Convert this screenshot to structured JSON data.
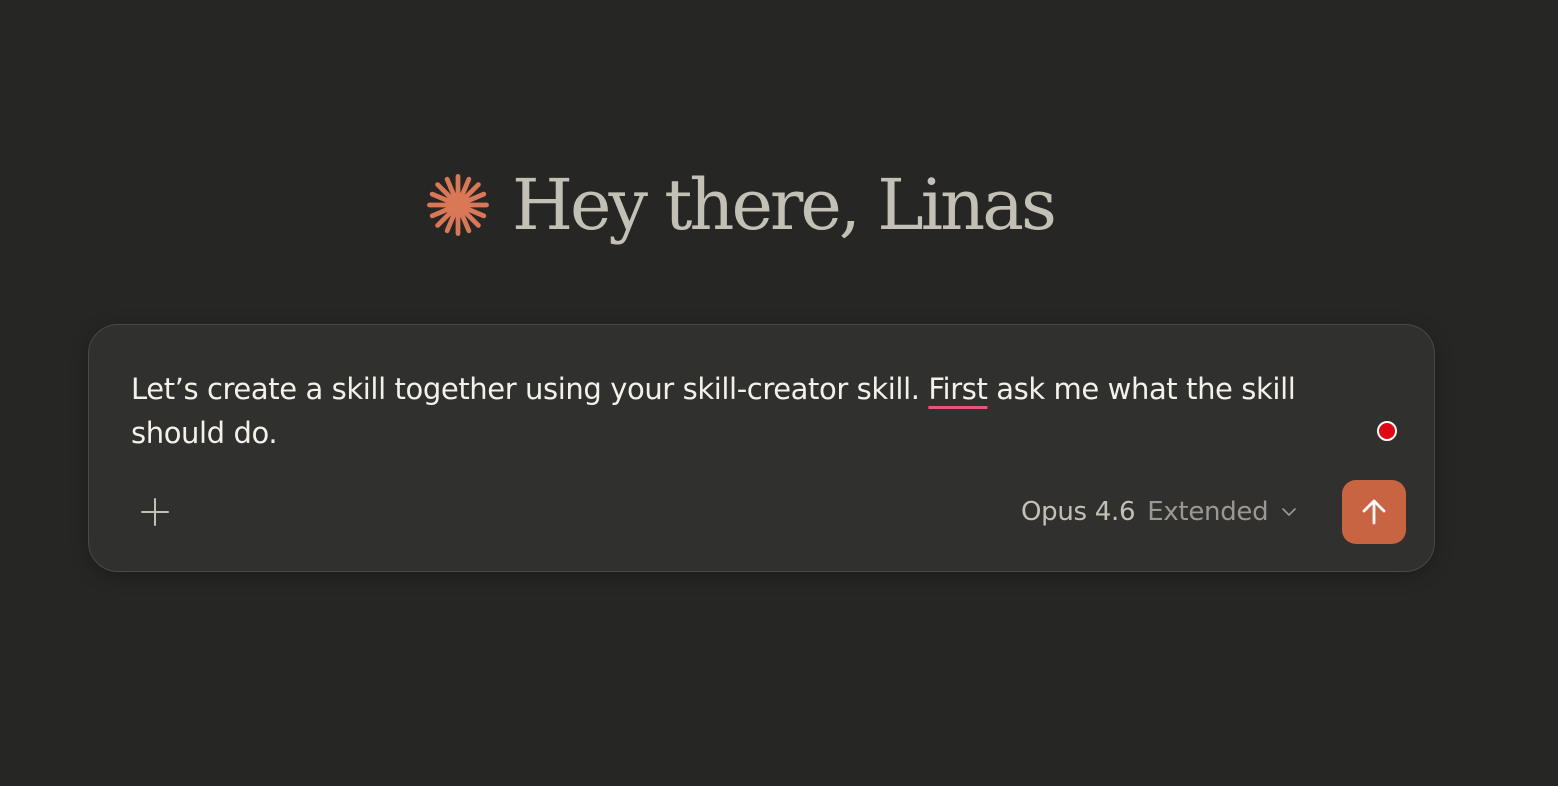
{
  "greeting": {
    "text": "Hey there, Linas",
    "icon": "claude-starburst-icon",
    "icon_color": "#d97757"
  },
  "composer": {
    "prompt_before": "Let’s create a skill together using your skill-creator skill. ",
    "prompt_flagged_word": "First",
    "prompt_after": " ask me what the skill should do.",
    "add_icon": "plus-icon",
    "model_name": "Opus 4.6",
    "model_mode": "Extended",
    "model_chevron_icon": "chevron-down-icon",
    "send_icon": "arrow-up-icon",
    "send_color": "#c96442",
    "recording_indicator_color": "#e30613",
    "spellcheck_underline_color": "#e8557a"
  },
  "colors": {
    "background": "#262624",
    "composer_background": "#30302e"
  }
}
